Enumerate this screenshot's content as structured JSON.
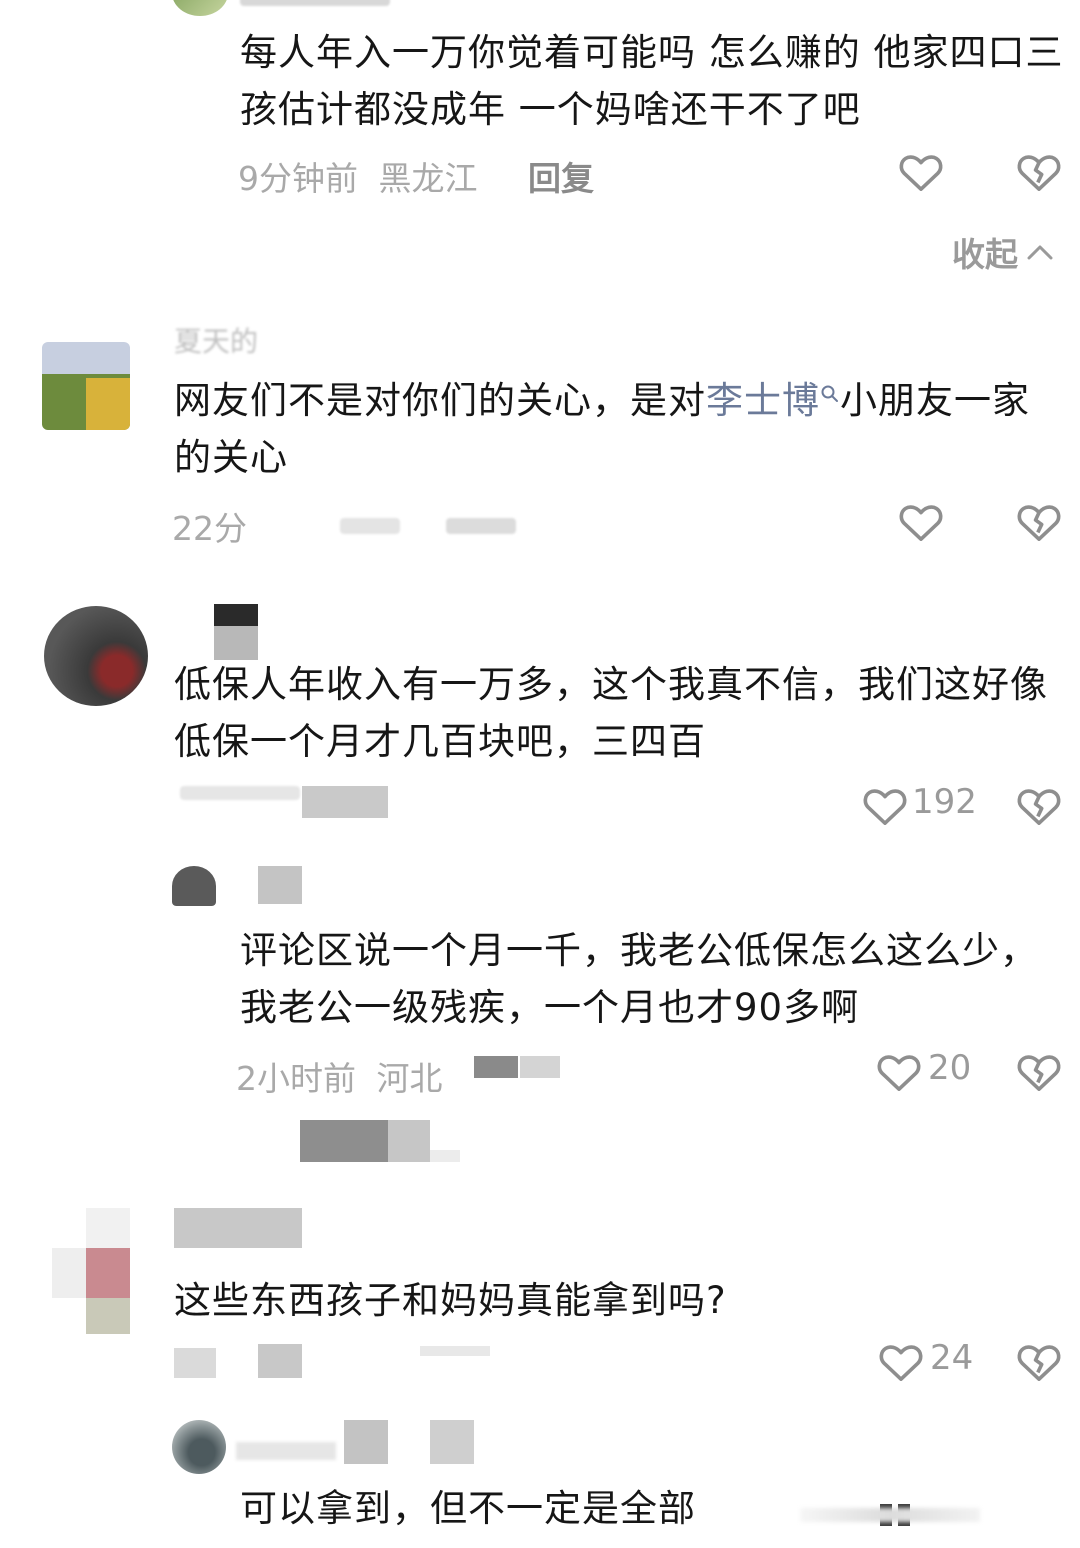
{
  "comments": [
    {
      "text": "每人年入一万你觉着可能吗 怎么赚的 他家四口三孩估计都没成年 一个妈啥还干不了吧",
      "meta_time": "9分钟前",
      "meta_location": "黑龙江",
      "reply_label": "回复"
    },
    {
      "username": "夏天的",
      "text_before": "网友们不是对你们的关心，是对",
      "link_text": "李士博",
      "text_after": "小朋友一家的关心",
      "meta_time": "22分"
    },
    {
      "text": "低保人年收入有一万多，这个我真不信，我们这好像低保一个月才几百块吧，三四百",
      "like_count": "192"
    },
    {
      "text": "评论区说一个月一千，我老公低保怎么这么少，我老公一级残疾，一个月也才90多啊",
      "meta_time": "2小时前",
      "meta_location": "河北",
      "like_count": "20"
    },
    {
      "text": "这些东西孩子和妈妈真能拿到吗?",
      "like_count": "24"
    },
    {
      "text": "可以拿到，但不一定是全部"
    }
  ],
  "collapse_label": "收起",
  "icons": {
    "like": "heart-outline-icon",
    "dislike": "broken-heart-icon",
    "collapse": "chevron-up-icon",
    "link_search": "search-icon"
  },
  "colors": {
    "text": "#161616",
    "meta": "#a9a9a9",
    "link": "#6b7a99"
  }
}
